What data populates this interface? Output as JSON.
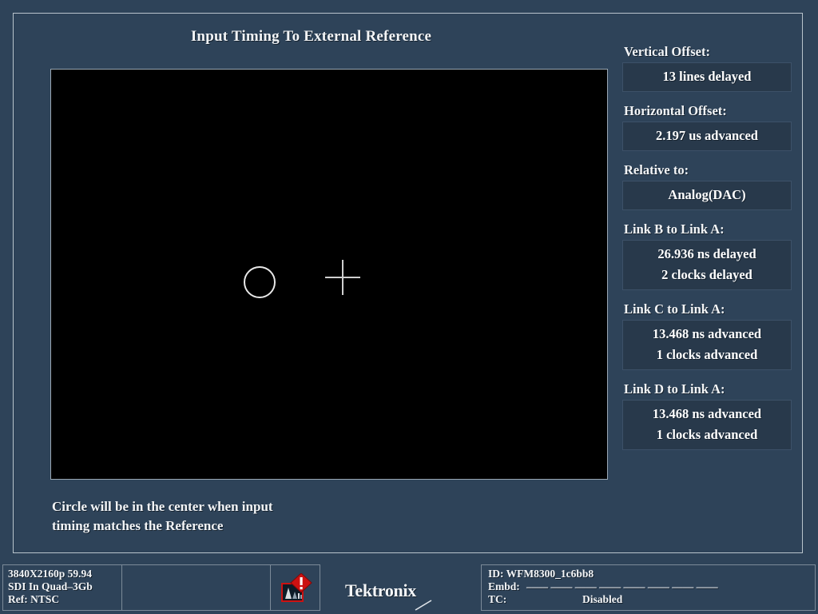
{
  "header": {
    "title": "Input Timing To External Reference"
  },
  "display": {
    "hint_line1": "Circle will be in the center when input",
    "hint_line2": "timing matches the Reference",
    "circle_icon": "timing-circle",
    "crosshair_icon": "reference-crosshair"
  },
  "readouts": [
    {
      "label": "Vertical Offset:",
      "values": [
        "13 lines delayed"
      ]
    },
    {
      "label": "Horizontal Offset:",
      "values": [
        "2.197 us advanced"
      ]
    },
    {
      "label": "Relative to:",
      "values": [
        "Analog(DAC)"
      ]
    },
    {
      "label": "Link B to Link A:",
      "values": [
        "26.936 ns delayed",
        "2 clocks delayed"
      ]
    },
    {
      "label": "Link C to Link A:",
      "values": [
        "13.468 ns advanced",
        "1 clocks advanced"
      ]
    },
    {
      "label": "Link D to Link A:",
      "values": [
        "13.468 ns advanced",
        "1 clocks advanced"
      ]
    }
  ],
  "status_bar": {
    "format_line1": "3840X2160p 59.94",
    "format_line2": "SDI In Quad–3Gb",
    "format_line3": "Ref: NTSC",
    "alarm_icon": "signal-alarm-icon",
    "id_label": "ID: WFM8300_1c6bb8",
    "embd_label": "Embd:",
    "embd_value": "–––– –––– –––– –––– –––– –––– –––– ––––",
    "tc_label": "TC:",
    "tc_value": "Disabled"
  },
  "branding": {
    "wordmark": "Tektronix"
  },
  "colors": {
    "background": "#2e4359",
    "frame_border": "#b9c4cc",
    "readout_box": "#28394b",
    "display_background": "#000000",
    "text": "#f2f4f6",
    "alarm_red": "#cc1111"
  }
}
